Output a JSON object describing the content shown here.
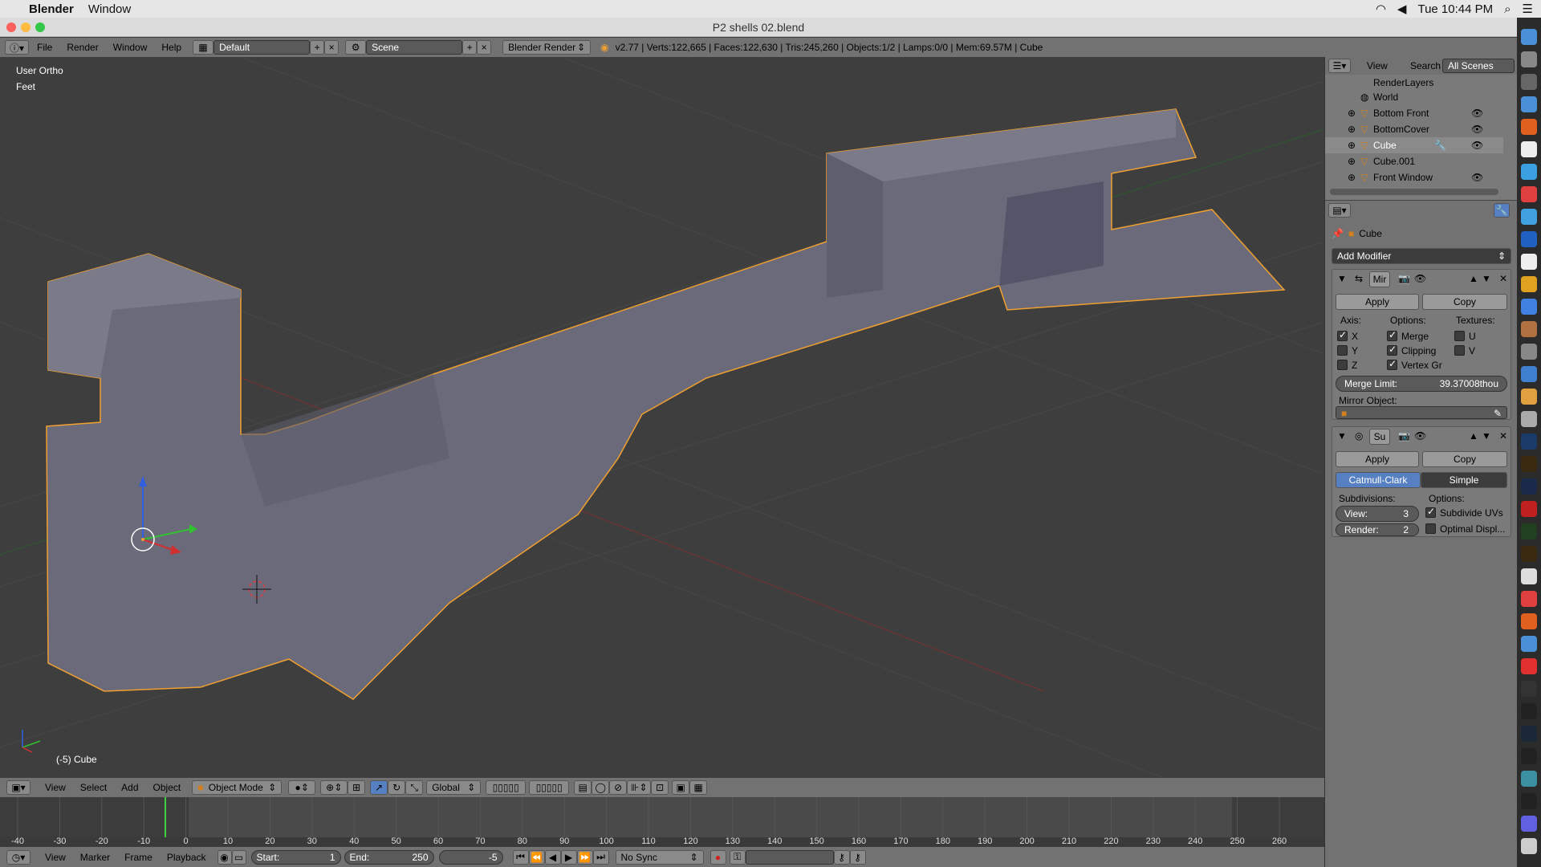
{
  "menubar": {
    "app_name": "Blender",
    "window_menu": "Window",
    "clock": "Tue 10:44 PM"
  },
  "titlebar": {
    "title": "P2 shells 02.blend"
  },
  "info_header": {
    "menus": [
      "File",
      "Render",
      "Window",
      "Help"
    ],
    "layout": "Default",
    "scene": "Scene",
    "engine": "Blender Render",
    "stats": "v2.77 | Verts:122,665 | Faces:122,630 | Tris:245,260 | Objects:1/2 | Lamps:0/0 | Mem:69.57M | Cube"
  },
  "viewport": {
    "view_name": "User Ortho",
    "units": "Feet",
    "object_label": "(-5) Cube"
  },
  "view3d_header": {
    "menus": [
      "View",
      "Select",
      "Add",
      "Object"
    ],
    "mode": "Object Mode",
    "orientation": "Global"
  },
  "timeline": {
    "ticks": [
      "-40",
      "-30",
      "-20",
      "-10",
      "0",
      "10",
      "20",
      "30",
      "40",
      "50",
      "60",
      "70",
      "80",
      "90",
      "100",
      "110",
      "120",
      "130",
      "140",
      "150",
      "160",
      "170",
      "180",
      "190",
      "200",
      "210",
      "220",
      "230",
      "240",
      "250",
      "260"
    ],
    "menus": [
      "View",
      "Marker",
      "Frame",
      "Playback"
    ],
    "start_label": "Start:",
    "start_value": "1",
    "end_label": "End:",
    "end_value": "250",
    "current_frame": "-5",
    "sync": "No Sync"
  },
  "outliner": {
    "header_tabs": [
      "View",
      "Search"
    ],
    "scenes_dropdown": "All Scenes",
    "items": [
      {
        "name": "RenderLayers"
      },
      {
        "name": "World"
      },
      {
        "name": "Bottom Front"
      },
      {
        "name": "BottomCover"
      },
      {
        "name": "Cube"
      },
      {
        "name": "Cube.001"
      },
      {
        "name": "Front Window"
      }
    ]
  },
  "properties": {
    "breadcrumb_object": "Cube",
    "add_modifier": "Add Modifier",
    "mirror": {
      "short_name": "Mir",
      "apply": "Apply",
      "copy": "Copy",
      "axis_label": "Axis:",
      "options_label": "Options:",
      "textures_label": "Textures:",
      "axis_x": "X",
      "axis_y": "Y",
      "axis_z": "Z",
      "merge": "Merge",
      "clipping": "Clipping",
      "vertex_groups": "Vertex Gr",
      "tex_u": "U",
      "tex_v": "V",
      "merge_limit_label": "Merge Limit:",
      "merge_limit_value": "39.37008thou",
      "mirror_object_label": "Mirror Object:"
    },
    "subsurf": {
      "short_name": "Su",
      "apply": "Apply",
      "copy": "Copy",
      "catmull": "Catmull-Clark",
      "simple": "Simple",
      "subdivisions_label": "Subdivisions:",
      "options_label": "Options:",
      "view_label": "View:",
      "view_value": "3",
      "render_label": "Render:",
      "render_value": "2",
      "subdivide_uvs": "Subdivide UVs",
      "optimal_display": "Optimal Displ..."
    }
  },
  "colors": {
    "selection_outline": "#f0a030",
    "mesh_face": "#6a6a7a",
    "active_tab": "#5680c2"
  }
}
